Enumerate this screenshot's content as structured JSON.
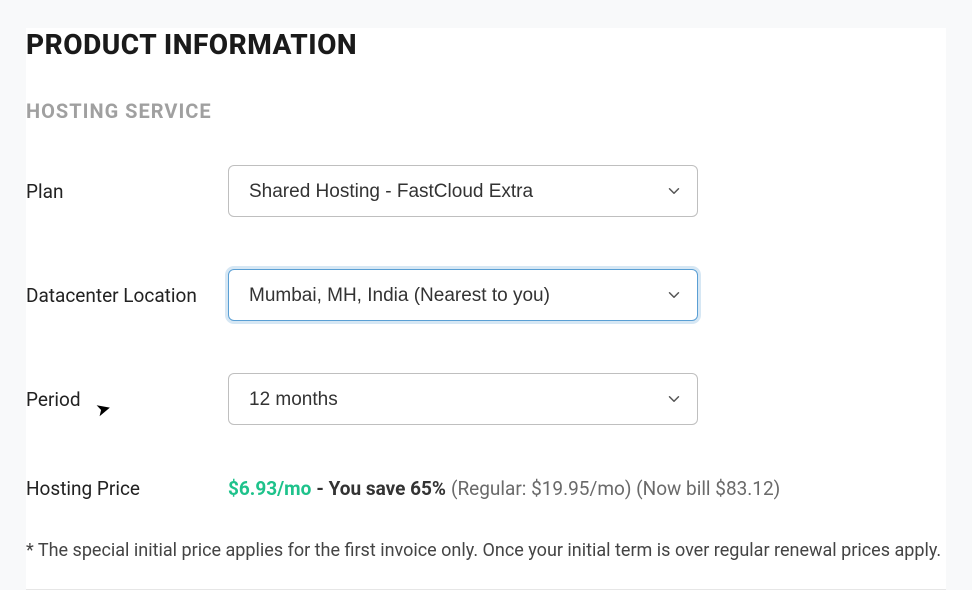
{
  "title": "PRODUCT INFORMATION",
  "section": "HOSTING SERVICE",
  "labels": {
    "plan": "Plan",
    "datacenter": "Datacenter Location",
    "period": "Period",
    "price": "Hosting Price"
  },
  "values": {
    "plan": "Shared Hosting - FastCloud Extra",
    "datacenter": "Mumbai, MH, India (Nearest to you)",
    "period": "12 months"
  },
  "pricing": {
    "rate": "$6.93/mo",
    "savings": "- You save 65%",
    "regular": "(Regular: $19.95/mo) (Now bill $83.12)"
  },
  "disclaimer": "* The special initial price applies for the first invoice only. Once your initial term is over regular renewal prices apply."
}
